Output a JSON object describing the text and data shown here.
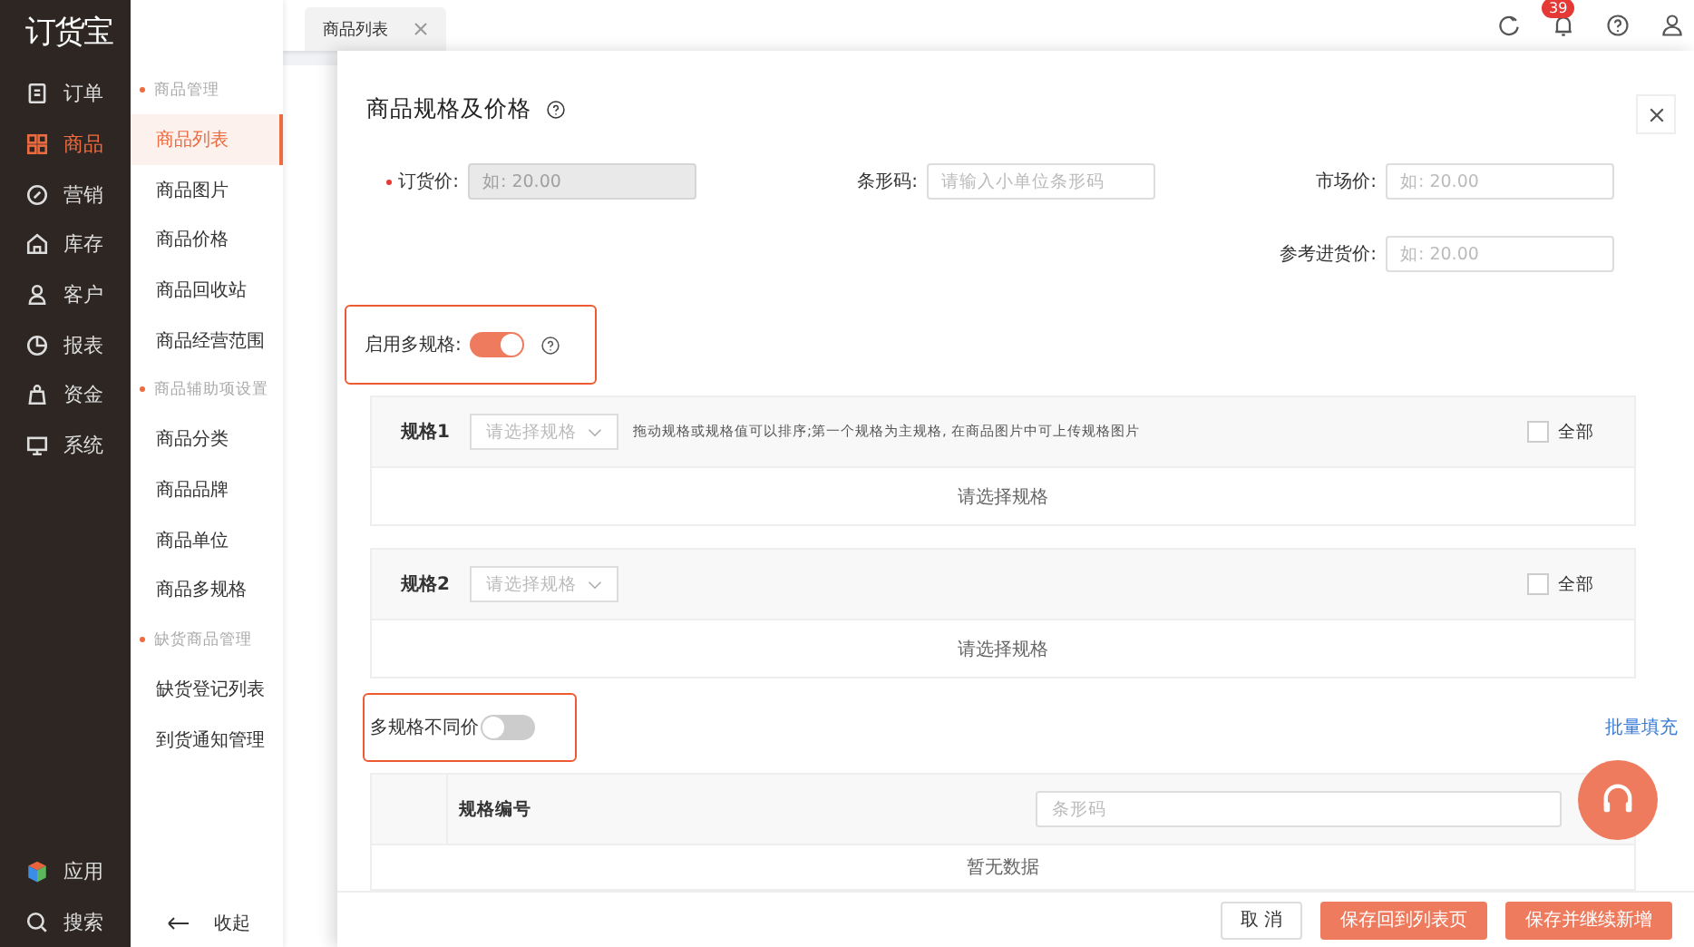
{
  "sidebar": {
    "logo": "订货宝",
    "items": [
      {
        "label": "订单",
        "selected": false
      },
      {
        "label": "商品",
        "selected": true
      },
      {
        "label": "营销",
        "selected": false
      },
      {
        "label": "库存",
        "selected": false
      },
      {
        "label": "客户",
        "selected": false
      },
      {
        "label": "报表",
        "selected": false
      },
      {
        "label": "资金",
        "selected": false
      },
      {
        "label": "系统",
        "selected": false
      }
    ],
    "bottom_items": [
      {
        "label": "应用"
      },
      {
        "label": "搜索"
      }
    ]
  },
  "submenu": {
    "groups": [
      {
        "title": "商品管理",
        "items": [
          {
            "label": "商品列表",
            "selected": true
          },
          {
            "label": "商品图片",
            "selected": false
          },
          {
            "label": "商品价格",
            "selected": false
          },
          {
            "label": "商品回收站",
            "selected": false
          },
          {
            "label": "商品经营范围",
            "selected": false
          }
        ]
      },
      {
        "title": "商品辅助项设置",
        "items": [
          {
            "label": "商品分类",
            "selected": false
          },
          {
            "label": "商品品牌",
            "selected": false
          },
          {
            "label": "商品单位",
            "selected": false
          },
          {
            "label": "商品多规格",
            "selected": false
          }
        ]
      },
      {
        "title": "缺货商品管理",
        "items": [
          {
            "label": "缺货登记列表",
            "selected": false
          },
          {
            "label": "到货通知管理",
            "selected": false
          }
        ]
      }
    ],
    "collapse": "收起"
  },
  "tabs": [
    {
      "label": "商品列表"
    }
  ],
  "header": {
    "badge": "39"
  },
  "drawer": {
    "title": "商品规格及价格",
    "fields": [
      {
        "label": "订货价:",
        "required": true,
        "placeholder": "如: 20.00",
        "disabled": true
      },
      {
        "label": "条形码:",
        "required": false,
        "placeholder": "请输入小单位条形码",
        "disabled": false
      },
      {
        "label": "市场价:",
        "required": false,
        "placeholder": "如: 20.00",
        "disabled": false
      },
      {
        "label": "参考进货价:",
        "required": false,
        "placeholder": "如: 20.00",
        "disabled": false
      }
    ],
    "multi_spec": {
      "label": "启用多规格:",
      "on": true
    },
    "specs": [
      {
        "label": "规格1",
        "select_placeholder": "请选择规格",
        "hint": "拖动规格或规格值可以排序;第一个规格为主规格, 在商品图片中可上传规格图片",
        "all_label": "全部",
        "all_checked": false,
        "empty_text": "请选择规格"
      },
      {
        "label": "规格2",
        "select_placeholder": "请选择规格",
        "all_label": "全部",
        "all_checked": false,
        "empty_text": "请选择规格"
      }
    ],
    "diff_price": {
      "label": "多规格不同价",
      "on": false
    },
    "batch_fill": "批量填充",
    "table": {
      "column_2": "规格编号",
      "barcode_placeholder": "条形码",
      "empty_text": "暂无数据"
    },
    "buttons": [
      {
        "label": "取 消",
        "kind": "default"
      },
      {
        "label": "保存回到列表页",
        "kind": "primary"
      },
      {
        "label": "保存并继续新增",
        "kind": "primary"
      }
    ]
  }
}
